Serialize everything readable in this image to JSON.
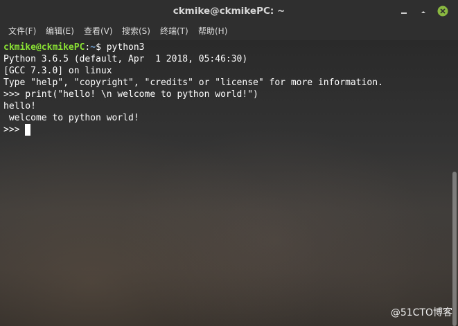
{
  "window": {
    "title": "ckmike@ckmikePC: ~"
  },
  "menu": {
    "items": [
      "文件(F)",
      "编辑(E)",
      "查看(V)",
      "搜索(S)",
      "终端(T)",
      "帮助(H)"
    ]
  },
  "terminal": {
    "prompt_user": "ckmike@ckmikePC",
    "prompt_sep": ":",
    "prompt_path": "~",
    "prompt_end": "$ python3",
    "lines": [
      "Python 3.6.5 (default, Apr  1 2018, 05:46:30)",
      "[GCC 7.3.0] on linux",
      "Type \"help\", \"copyright\", \"credits\" or \"license\" for more information.",
      ">>> print(\"hello! \\n welcome to python world!\")",
      "hello!",
      " welcome to python world!"
    ],
    "current_prompt": ">>> "
  },
  "watermark": "@51CTO博客",
  "colors": {
    "prompt_user": "#8ae234",
    "prompt_path": "#729fcf",
    "text": "#ffffff"
  },
  "icons": {
    "minimize": "minimize-icon",
    "maximize": "maximize-icon",
    "close": "close-icon"
  }
}
